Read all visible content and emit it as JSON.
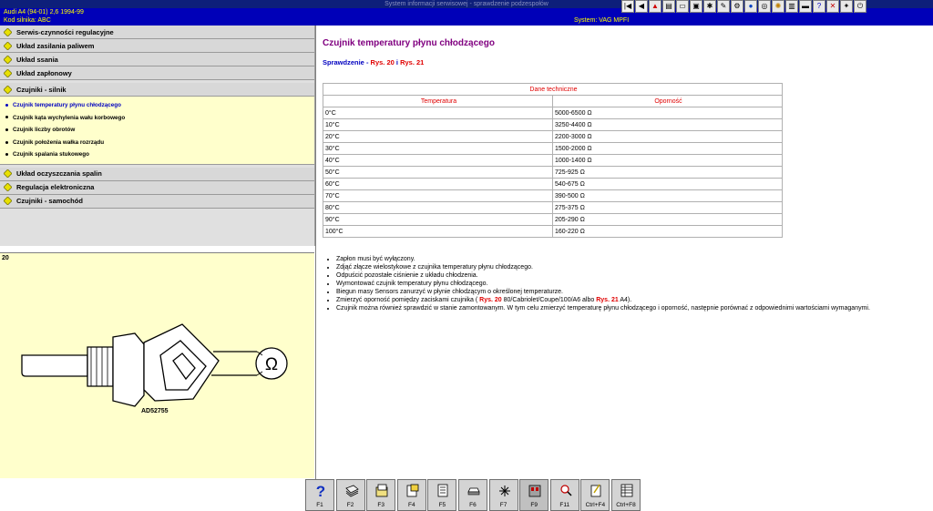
{
  "window": {
    "title": "System informacji serwisowej - sprawdzenie podzespołów"
  },
  "vehicle": {
    "line1": "Audi    A4 (94-01) 2,6   1994-99",
    "line2": "Kod silnika: ABC",
    "system": "System: VAG MPFI"
  },
  "toolbar": {
    "icons": [
      "first-icon",
      "prev-icon",
      "warning-icon",
      "book-icon",
      "car-icon",
      "engine-icon",
      "gear-icon",
      "tool-icon",
      "wrench-icon",
      "drop-icon",
      "wheel-icon",
      "light-icon",
      "print-icon",
      "car2-icon",
      "help-icon",
      "x-icon",
      "spark-icon",
      "exit-icon"
    ]
  },
  "menu": {
    "categories": [
      {
        "label": "Serwis-czynności regulacyjne"
      },
      {
        "label": "Układ zasilania paliwem"
      },
      {
        "label": "Układ ssania"
      },
      {
        "label": "Układ zapłonowy"
      },
      {
        "label": "Czujniki - silnik"
      }
    ],
    "subitems": [
      {
        "label": "Czujnik temperatury płynu chłodzącego"
      },
      {
        "label": "Czujnik kąta wychylenia wału korbowego"
      },
      {
        "label": "Czujnik liczby obrotów"
      },
      {
        "label": "Czujnik położenia wałka rozrządu"
      },
      {
        "label": "Czujnik spalania stukowego"
      }
    ],
    "categories_after": [
      {
        "label": "Układ oczyszczania spalin"
      },
      {
        "label": "Regulacja elektroniczna"
      },
      {
        "label": "Czujniki - samochód"
      }
    ]
  },
  "figure": {
    "number": "20",
    "code": "AD52755",
    "symbol": "Ω"
  },
  "content": {
    "title": "Czujnik temperatury płynu chłodzącego",
    "check_label": "Sprawdzenie",
    "check_sep": " - ",
    "fig1": "Rys. 20",
    "and": " i ",
    "fig2": "Rys. 21",
    "table_title": "Dane techniczne",
    "col_temp": "Temperatura",
    "col_res": "Oporność",
    "rows": [
      [
        "0°C",
        "5000-6500 Ω"
      ],
      [
        "10°C",
        "3250-4400 Ω"
      ],
      [
        "20°C",
        "2200-3000 Ω"
      ],
      [
        "30°C",
        "1500-2000 Ω"
      ],
      [
        "40°C",
        "1000-1400 Ω"
      ],
      [
        "50°C",
        "725-925 Ω"
      ],
      [
        "60°C",
        "540-675 Ω"
      ],
      [
        "70°C",
        "390-500 Ω"
      ],
      [
        "80°C",
        "275-375 Ω"
      ],
      [
        "90°C",
        "205-290 Ω"
      ],
      [
        "100°C",
        "160-220 Ω"
      ]
    ],
    "steps": {
      "s1": "Zapłon musi być wyłączony.",
      "s2": "Zdjąć złącze wielostykowe z czujnika temperatury płynu chłodzącego.",
      "s3": "Odpuścić pozostałe ciśnienie z układu chłodzenia.",
      "s4": "Wymontować czujnik temperatury płynu chłodzącego.",
      "s5": "Biegun masy Sensors zanurzyć w płynie chłodzącym o określonej temperaturze.",
      "s6a": "Zmierzyć oporność pomiędzy zaciskami czujnika (",
      "s6r1": "Rys. 20",
      "s6b": " 80/Cabriolet/Coupe/100/A6 albo ",
      "s6r2": "Rys. 21",
      "s6c": " A4).",
      "s7": "Czujnik można również sprawdzić w stanie zamontowanym. W tym celu zmierzyć temperaturę płynu chłodzącego i oporność, następnie porównać z odpowiednimi wartościami wymaganymi."
    }
  },
  "fkeys": [
    {
      "label": "F1",
      "icon": "help-icon"
    },
    {
      "label": "F2",
      "icon": "book-icon"
    },
    {
      "label": "F3",
      "icon": "folder-icon"
    },
    {
      "label": "F4",
      "icon": "document-icon"
    },
    {
      "label": "F5",
      "icon": "list-icon"
    },
    {
      "label": "F6",
      "icon": "car-icon"
    },
    {
      "label": "F7",
      "icon": "tool-icon"
    },
    {
      "label": "F9",
      "icon": "engine-icon"
    },
    {
      "label": "F11",
      "icon": "search-icon"
    },
    {
      "label": "Ctrl+F4",
      "icon": "note-icon"
    },
    {
      "label": "Ctrl+F8",
      "icon": "table-icon"
    }
  ]
}
